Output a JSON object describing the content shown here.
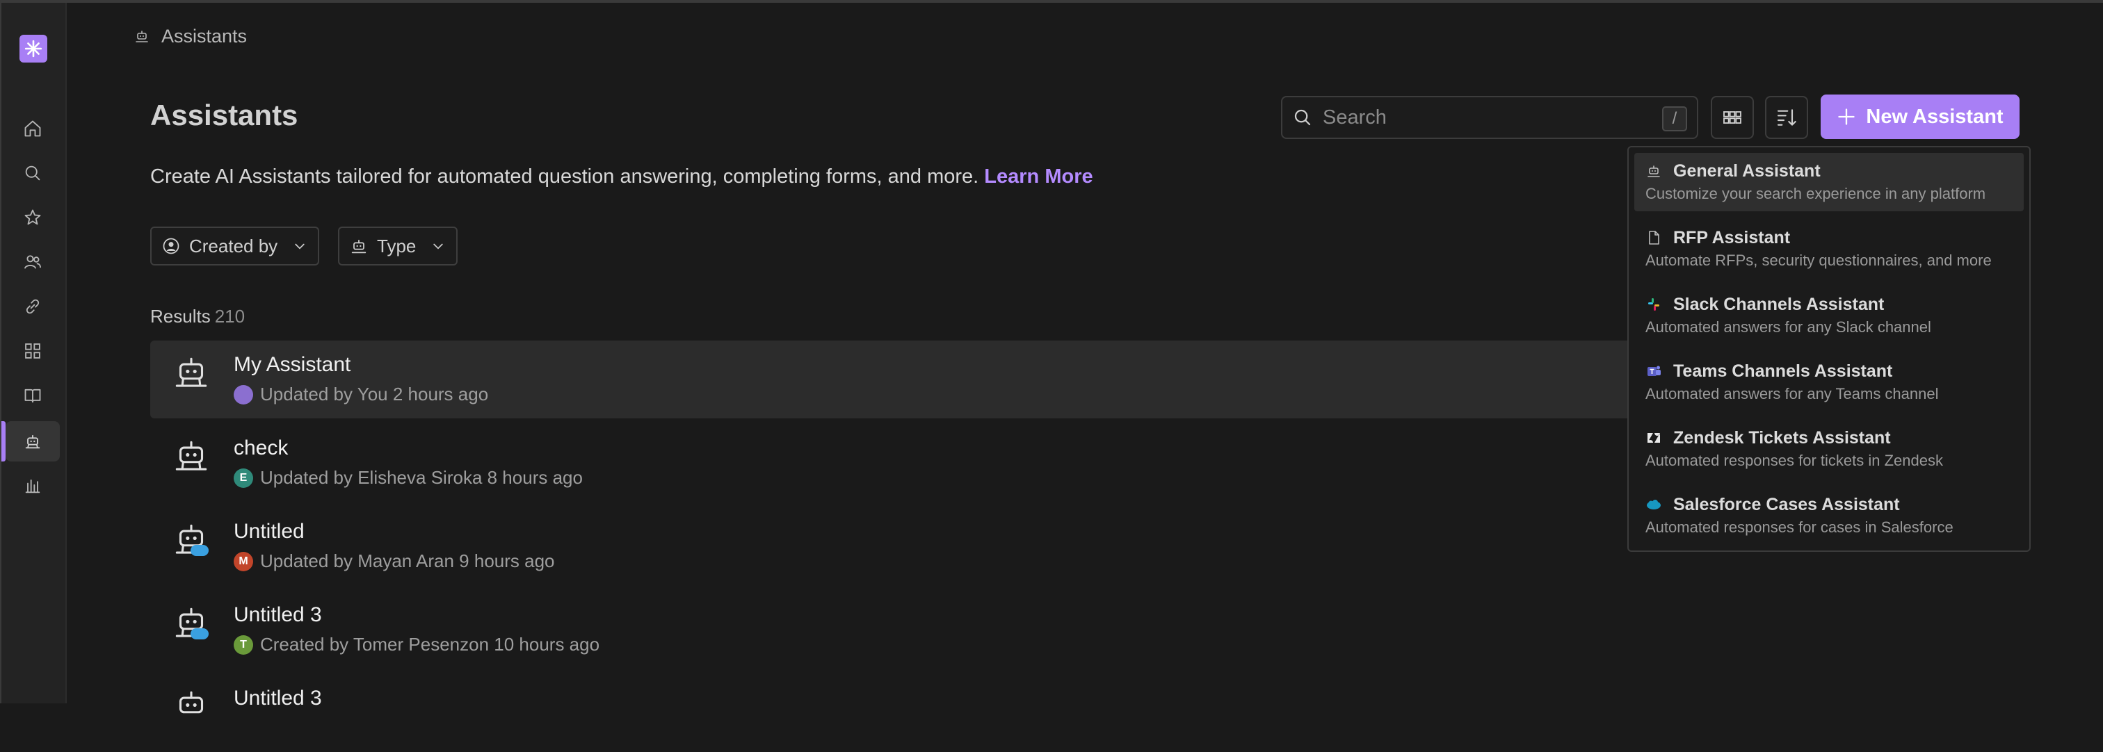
{
  "breadcrumb": {
    "label": "Assistants"
  },
  "page": {
    "title": "Assistants",
    "subtitle": "Create AI Assistants tailored for automated question answering, completing forms, and more.",
    "learn_more": "Learn More"
  },
  "search": {
    "placeholder": "Search",
    "shortcut": "/"
  },
  "toolbar": {
    "new_label": "New Assistant"
  },
  "filters": {
    "created_by": "Created by",
    "type": "Type"
  },
  "results": {
    "label": "Results",
    "count": "210"
  },
  "colors": {
    "accent": "#a87ff5",
    "background": "#1a1a1a",
    "sidebar": "#232323"
  },
  "sidebar": {
    "items": [
      {
        "icon": "home-icon"
      },
      {
        "icon": "search-icon"
      },
      {
        "icon": "star-icon"
      },
      {
        "icon": "users-icon"
      },
      {
        "icon": "link-icon"
      },
      {
        "icon": "apps-grid-icon"
      },
      {
        "icon": "book-icon"
      },
      {
        "icon": "assistant-icon",
        "active": true
      },
      {
        "icon": "bar-chart-icon"
      }
    ]
  },
  "assistants": [
    {
      "title": "My Assistant",
      "meta": "Updated by You 2 hours ago",
      "avatar": "",
      "avatar_color": "#8b6fd0",
      "badge": false
    },
    {
      "title": "check",
      "meta": "Updated by Elisheva Siroka 8 hours ago",
      "avatar": "E",
      "avatar_color": "#2f8a7a",
      "badge": false
    },
    {
      "title": "Untitled",
      "meta": "Updated by Mayan Aran 9 hours ago",
      "avatar": "M",
      "avatar_color": "#c2452a",
      "badge": true
    },
    {
      "title": "Untitled 3",
      "meta": "Created by Tomer Pesenzon 10 hours ago",
      "avatar": "T",
      "avatar_color": "#6a9a3a",
      "badge": true
    },
    {
      "title": "Untitled 3",
      "meta": "",
      "avatar": "",
      "avatar_color": "",
      "badge": false
    }
  ],
  "new_menu": [
    {
      "title": "General Assistant",
      "desc": "Customize your search experience in any platform",
      "icon": "assistant-icon"
    },
    {
      "title": "RFP Assistant",
      "desc": "Automate RFPs, security questionnaires, and more",
      "icon": "document-icon"
    },
    {
      "title": "Slack Channels Assistant",
      "desc": "Automated answers for any Slack channel",
      "icon": "slack-icon"
    },
    {
      "title": "Teams Channels Assistant",
      "desc": "Automated answers for any Teams channel",
      "icon": "teams-icon"
    },
    {
      "title": "Zendesk Tickets Assistant",
      "desc": "Automated responses for tickets in Zendesk",
      "icon": "zendesk-icon"
    },
    {
      "title": "Salesforce Cases Assistant",
      "desc": "Automated responses for cases in Salesforce",
      "icon": "salesforce-icon"
    }
  ]
}
